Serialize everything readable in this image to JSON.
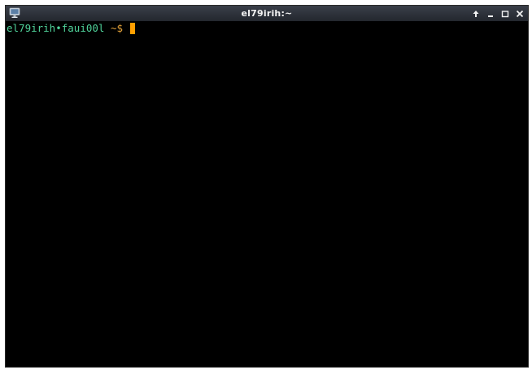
{
  "window": {
    "title": "el79irih:~",
    "icons": {
      "app": "monitor-icon",
      "controls": [
        "keep-above-icon",
        "minimize-icon",
        "maximize-icon",
        "close-icon"
      ]
    },
    "colors": {
      "titlebar": "#2a2e35",
      "background": "#000000",
      "prompt_text": "#4fd29a",
      "prompt_path": "#e4a33a",
      "cursor": "#ff9f00"
    }
  },
  "terminal": {
    "prompt": {
      "user": "el79irih",
      "separator": "•",
      "host": "faui00l",
      "path": "~",
      "symbol": "$"
    }
  }
}
